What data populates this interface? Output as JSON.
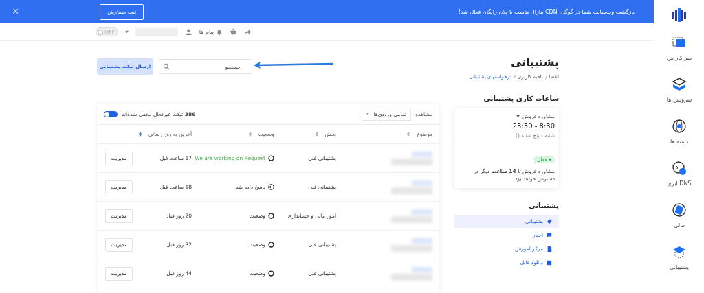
{
  "banner": {
    "message": "بازگشت وب‌سایت شما در گوگل، CDN مارال هاست با پلان رایگان فعال شد!",
    "button": "ثبت سفارش",
    "close": "×"
  },
  "toolbar": {
    "messages": "پیام ها",
    "toggle": {
      "label": "OFF",
      "on": false
    }
  },
  "page": {
    "title": "پشتیبانی",
    "breadcrumb": [
      {
        "label": "اعضا",
        "current": false
      },
      {
        "label": "ناحیه کاربری",
        "current": false
      },
      {
        "label": "درخواستهای پشتیبانی",
        "current": true
      }
    ]
  },
  "search": {
    "placeholder": "جستجو"
  },
  "send_button": "ارسال تیکت پشتیبانی",
  "tickets": {
    "view_label": "مشاهده",
    "filter": "تمامی ورودی‌ها",
    "hidden_note": "**386** تیکت غیرفعال مخفی شده‌اند",
    "hide_inactive": true,
    "columns": [
      {
        "label": "موضوع",
        "sorted": false
      },
      {
        "label": "بخش",
        "sorted": false
      },
      {
        "label": "وضعیت",
        "sorted": false
      },
      {
        "label": "آخرین به روز رسانی",
        "sorted": true
      }
    ],
    "rows": [
      {
        "department": "پشتیبانی فنی",
        "status": "We are working on Request",
        "kind": "working",
        "updated": "17 ساعت قبل",
        "action": "مدیریت"
      },
      {
        "department": "پشتیبانی فنی",
        "status": "پاسخ داده شد",
        "kind": "answered",
        "updated": "18 ساعت قبل",
        "action": "مدیریت"
      },
      {
        "department": "امور مالی و حسابداری",
        "status": "وضعیت",
        "kind": "open",
        "updated": "20 روز قبل",
        "action": "مدیریت"
      },
      {
        "department": "پشتیبانی فنی",
        "status": "وضعیت",
        "kind": "open",
        "updated": "32 روز قبل",
        "action": "مدیریت"
      },
      {
        "department": "پشتیبانی فنی",
        "status": "وضعیت",
        "kind": "open",
        "updated": "44 روز قبل",
        "action": "مدیریت"
      }
    ]
  },
  "hours": {
    "title": "ساعات کاری پشتیبانی",
    "department": "مشاوره فروش",
    "time": "23:30 - 8:30",
    "days": "شنبه - پنج شنبه ()",
    "status": "فعال",
    "active": true,
    "note": "مشاوره فروش تا **14 ساعت** دیگر در دسترس خواهد بود"
  },
  "support_menu": {
    "title": "پشتیبانی",
    "items": [
      {
        "label": "پشتیبانی",
        "selected": true
      },
      {
        "label": "اخبار",
        "selected": false
      },
      {
        "label": "مرکز آموزش",
        "selected": false
      },
      {
        "label": "دانلود فایل",
        "selected": false
      }
    ]
  },
  "sidebar": {
    "items": [
      {
        "label": "میز کار من"
      },
      {
        "label": "سرویس ها"
      },
      {
        "label": "دامنه ها"
      },
      {
        "label": "DNS ابری"
      },
      {
        "label": "مالی"
      },
      {
        "label": "پشتیبانی"
      }
    ]
  }
}
